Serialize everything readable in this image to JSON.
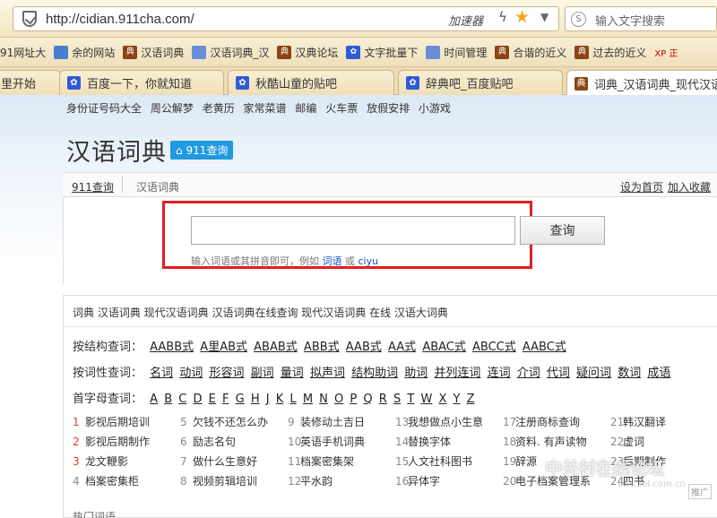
{
  "browser": {
    "url": "http://cidian.911cha.com/",
    "accelerator": "加速器",
    "search_placeholder": "输入文字搜索"
  },
  "bookmarks": [
    "91网址大",
    "余的网站",
    "汉语词典",
    "汉语词典_汉",
    "汉典论坛",
    "文字批量下",
    "时间管理",
    "合谐的近义",
    "过去的近义",
    "XP 正"
  ],
  "tabs": [
    "里开始",
    "百度一下，你就知道",
    "秋酷山童的贴吧",
    "辞典吧_百度贴吧",
    "词典_汉语词典_现代汉语"
  ],
  "site": {
    "top_links": [
      "身份证号码大全",
      "周公解梦",
      "老黄历",
      "家常菜谱",
      "邮编",
      "火车票",
      "放假安排",
      "小游戏"
    ],
    "title": "汉语词典",
    "badge": "911查询",
    "crumb_home": "911查询",
    "crumb_current": "汉语词典",
    "set_home": "设为首页",
    "add_fav": "加入收藏"
  },
  "search": {
    "button": "查询",
    "hint_prefix": "输入词语或其拼音即可，例如",
    "example1": "词语",
    "or": "或",
    "example2": "ciyu"
  },
  "keywords": "词典 汉语词典 现代汉语词典 汉语词典在线查询 现代汉语词典 在线 汉语大词典",
  "by_structure": {
    "label": "按结构查词：",
    "items": [
      "AABB式",
      "A里AB式",
      "ABAB式",
      "ABB式",
      "AAB式",
      "AA式",
      "ABAC式",
      "ABCC式",
      "AABC式"
    ]
  },
  "by_pos": {
    "label": "按词性查词：",
    "items": [
      "名词",
      "动词",
      "形容词",
      "副词",
      "量词",
      "拟声词",
      "结构助词",
      "助词",
      "并列连词",
      "连词",
      "介词",
      "代词",
      "疑问词",
      "数词",
      "成语"
    ]
  },
  "by_initial": {
    "label": "首字母查词：",
    "items": [
      "A",
      "B",
      "C",
      "D",
      "E",
      "F",
      "G",
      "H",
      "J",
      "K",
      "L",
      "M",
      "N",
      "O",
      "P",
      "Q",
      "R",
      "S",
      "T",
      "W",
      "X",
      "Y",
      "Z"
    ]
  },
  "hot_columns": [
    [
      {
        "n": "1",
        "t": "影视后期培训"
      },
      {
        "n": "2",
        "t": "影视后期制作"
      },
      {
        "n": "3",
        "t": "龙文鞭影"
      },
      {
        "n": "4",
        "t": "档案密集柜"
      }
    ],
    [
      {
        "n": "5",
        "t": "欠钱不还怎么办"
      },
      {
        "n": "6",
        "t": "励志名句"
      },
      {
        "n": "7",
        "t": "做什么生意好"
      },
      {
        "n": "8",
        "t": "视频剪辑培训"
      }
    ],
    [
      {
        "n": "9",
        "t": "装修动土吉日"
      },
      {
        "n": "10",
        "t": "英语手机词典"
      },
      {
        "n": "11",
        "t": "档案密集架"
      },
      {
        "n": "12",
        "t": "平水韵"
      }
    ],
    [
      {
        "n": "13",
        "t": "我想做点小生意"
      },
      {
        "n": "14",
        "t": "替换字体"
      },
      {
        "n": "15",
        "t": "人文社科图书"
      },
      {
        "n": "16",
        "t": "异体字"
      }
    ],
    [
      {
        "n": "17",
        "t": "注册商标查询"
      },
      {
        "n": "18",
        "t": "资料. 有声读物"
      },
      {
        "n": "19",
        "t": "辞源"
      },
      {
        "n": "20",
        "t": "电子档案管理系"
      }
    ],
    [
      {
        "n": "21",
        "t": "韩汉翻译"
      },
      {
        "n": "22",
        "t": "虚词"
      },
      {
        "n": "23",
        "t": "后期制作"
      },
      {
        "n": "24",
        "t": "四书"
      }
    ]
  ],
  "hot_heading": "热门词语",
  "watermark": "中关村在线论坛",
  "watermark_url": "bbs.zol.com.cn",
  "ad_tag": "推广"
}
